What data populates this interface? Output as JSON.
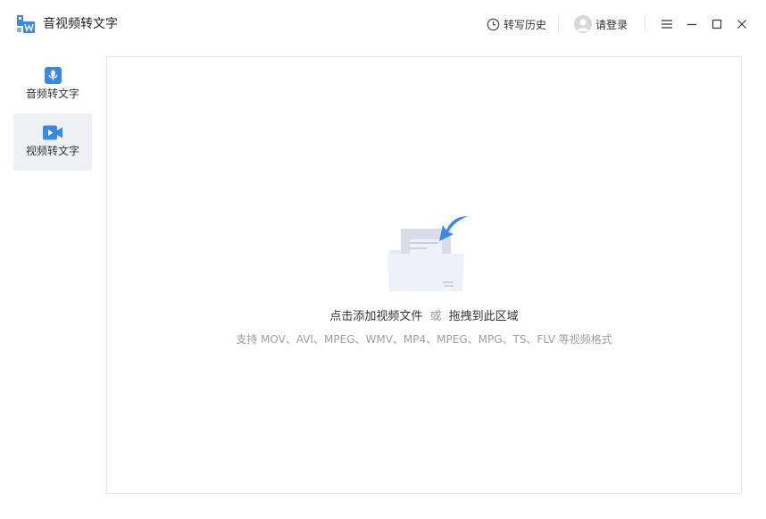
{
  "app": {
    "title": "音视频转文字",
    "accent": "#3a87e8"
  },
  "header": {
    "history_label": "转写历史",
    "login_label": "请登录",
    "icons": [
      "clock-icon",
      "avatar",
      "menu-icon",
      "minimize-icon",
      "maximize-icon",
      "close-icon"
    ]
  },
  "sidebar": {
    "items": [
      {
        "label": "音频转文字",
        "icon": "microphone-icon",
        "active": false
      },
      {
        "label": "视频转文字",
        "icon": "video-icon",
        "active": true
      }
    ]
  },
  "main": {
    "drop_text_a": "点击添加视频文件",
    "drop_text_or": "或",
    "drop_text_b": "拖拽到此区域",
    "supported_formats": "支持 MOV、AVI、MPEG、WMV、MP4、MPEG、MPG、TS、FLV 等视频格式"
  }
}
